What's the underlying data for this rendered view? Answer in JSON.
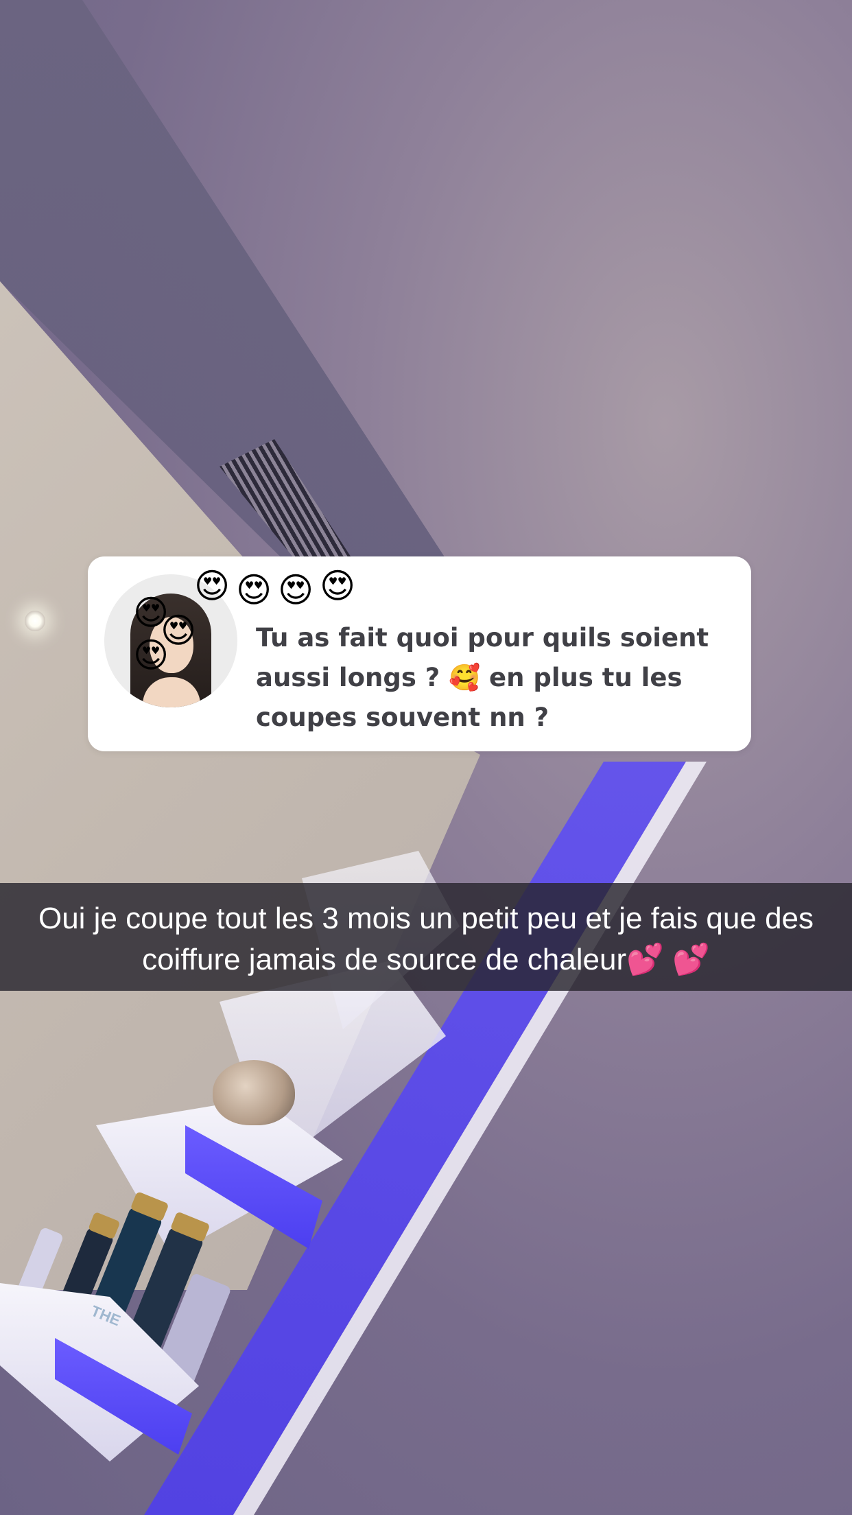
{
  "question": {
    "text": "Tu as fait quoi pour quils soient aussi longs ? 🥰 en plus tu les coupes souvent nn ?",
    "decoration_emojis": [
      "😍",
      "😍",
      "😍",
      "😍",
      "😍",
      "😍",
      "😍"
    ]
  },
  "caption": {
    "text": "Oui je coupe tout les 3 mois un petit peu et je fais que des coiffure jamais de source de chaleur💕 💕"
  },
  "background": {
    "bottle_label": "THE"
  }
}
